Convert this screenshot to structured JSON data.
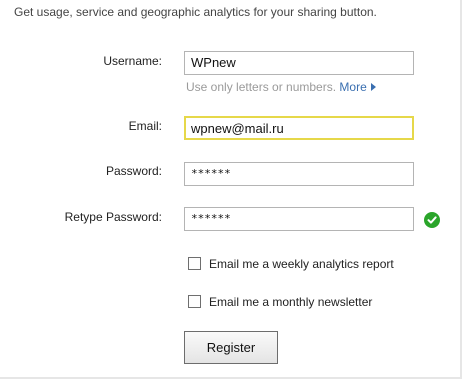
{
  "intro": "Get usage, service and geographic analytics for your sharing button.",
  "form": {
    "username_label": "Username:",
    "username_value": "WPnew",
    "username_hint": "Use only letters or numbers.",
    "username_more_link": "More",
    "email_label": "Email:",
    "email_value": "wpnew@mail.ru",
    "password_label": "Password:",
    "password_value": "******",
    "retype_label": "Retype Password:",
    "retype_value": "******",
    "retype_status_icon": "green-checkmark-icon",
    "weekly_report_label": "Email me a weekly analytics report",
    "weekly_report_checked": false,
    "newsletter_label": "Email me a monthly newsletter",
    "newsletter_checked": false,
    "register_label": "Register"
  },
  "colors": {
    "focus_border": "#e6d84a",
    "link": "#3a6fb0",
    "valid": "#2aa52a"
  }
}
